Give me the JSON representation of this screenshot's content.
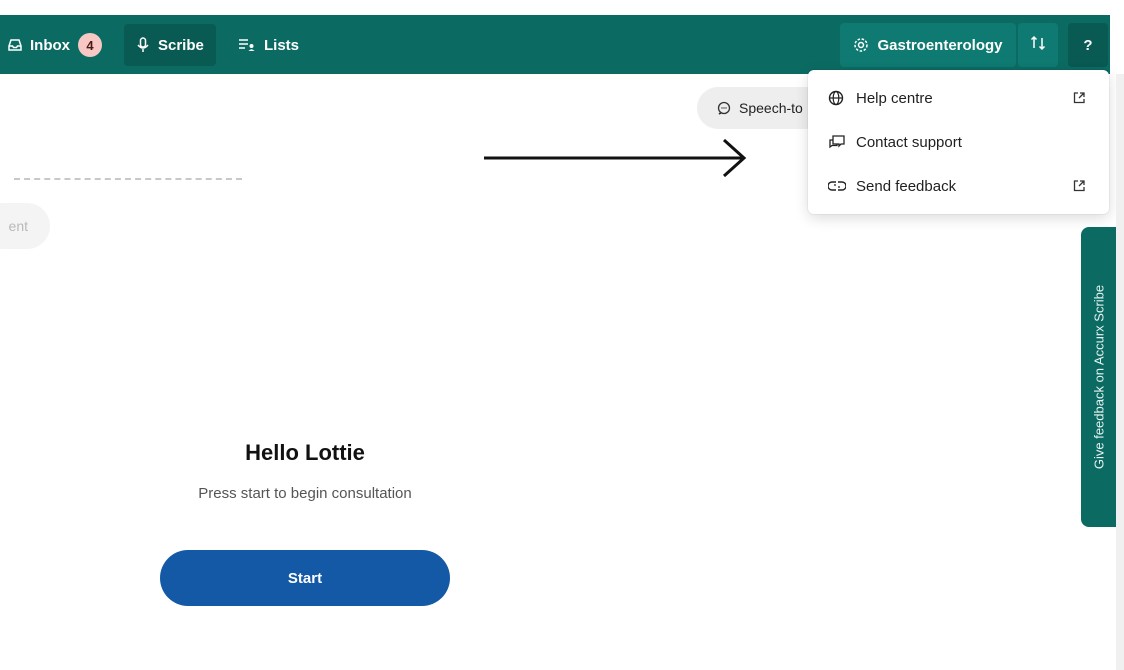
{
  "nav": {
    "inbox_label": "Inbox",
    "inbox_count": "4",
    "scribe_label": "Scribe",
    "lists_label": "Lists",
    "specialty_label": "Gastroenterology",
    "help_label": "?"
  },
  "speech_chip": {
    "label": "Speech-to"
  },
  "faded_pill": {
    "label": "ent"
  },
  "help_menu": {
    "items": [
      {
        "label": "Help centre",
        "icon": "globe-icon",
        "external": true
      },
      {
        "label": "Contact support",
        "icon": "chat-icon",
        "external": false
      },
      {
        "label": "Send feedback",
        "icon": "feedback-icon",
        "external": true
      }
    ]
  },
  "side_feedback": {
    "label": "Give feedback on Accurx Scribe"
  },
  "main": {
    "greeting": "Hello Lottie",
    "instruction": "Press start to begin consultation",
    "start_label": "Start"
  },
  "colors": {
    "topbar": "#0b6b63",
    "start_button": "#1359a6",
    "badge": "#f8c9c4"
  }
}
